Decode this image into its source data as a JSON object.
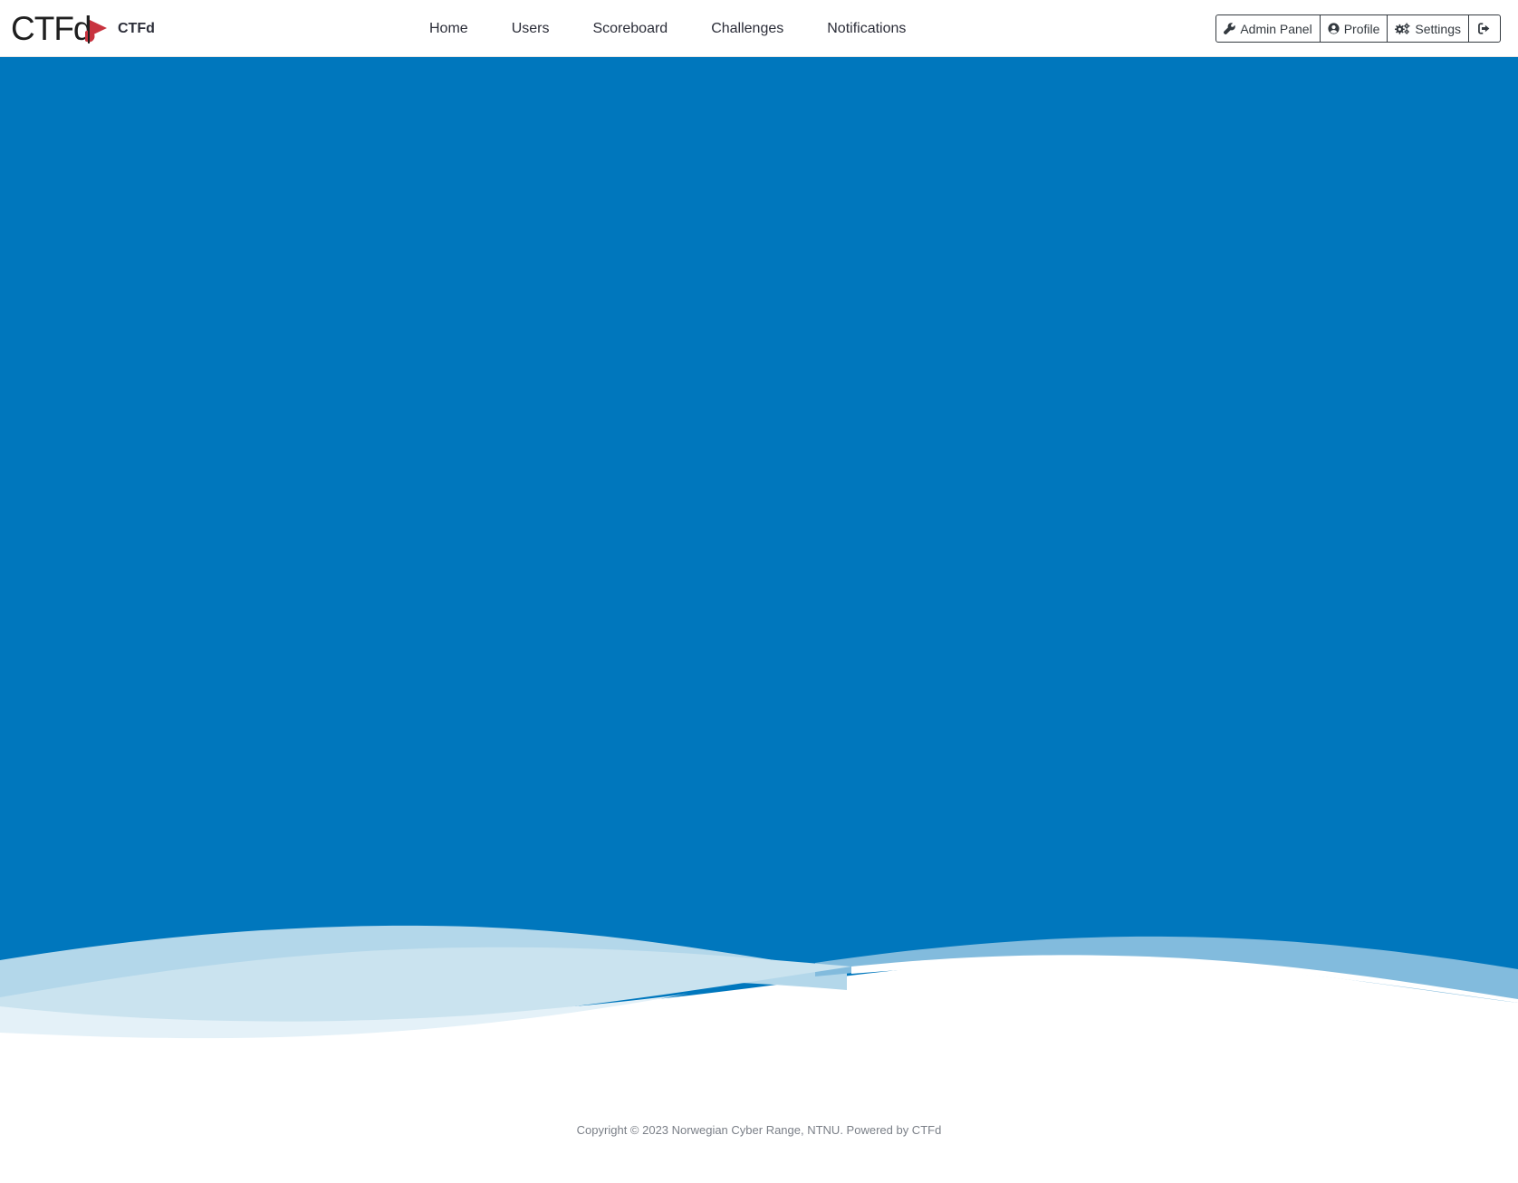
{
  "brand": {
    "logo_text": "CTFd",
    "name": "CTFd"
  },
  "nav": {
    "items": [
      {
        "label": "Home"
      },
      {
        "label": "Users"
      },
      {
        "label": "Scoreboard"
      },
      {
        "label": "Challenges"
      },
      {
        "label": "Notifications"
      }
    ]
  },
  "user_menu": {
    "admin_label": "Admin Panel",
    "profile_label": "Profile",
    "settings_label": "Settings",
    "admin_icon": "wrench-icon",
    "profile_icon": "user-circle-icon",
    "settings_icon": "cogs-icon",
    "logout_icon": "sign-out-icon"
  },
  "colors": {
    "hero_blue": "#0077bd",
    "wave_light": "#b3d7ea",
    "wave_mid": "#82bbdd",
    "wave_pale": "#cae3ef",
    "wave_palest": "#e4f1f8",
    "brand_flag": "#c8333f"
  },
  "footer": {
    "text": "Copyright © 2023 Norwegian Cyber Range, NTNU. Powered by CTFd"
  }
}
